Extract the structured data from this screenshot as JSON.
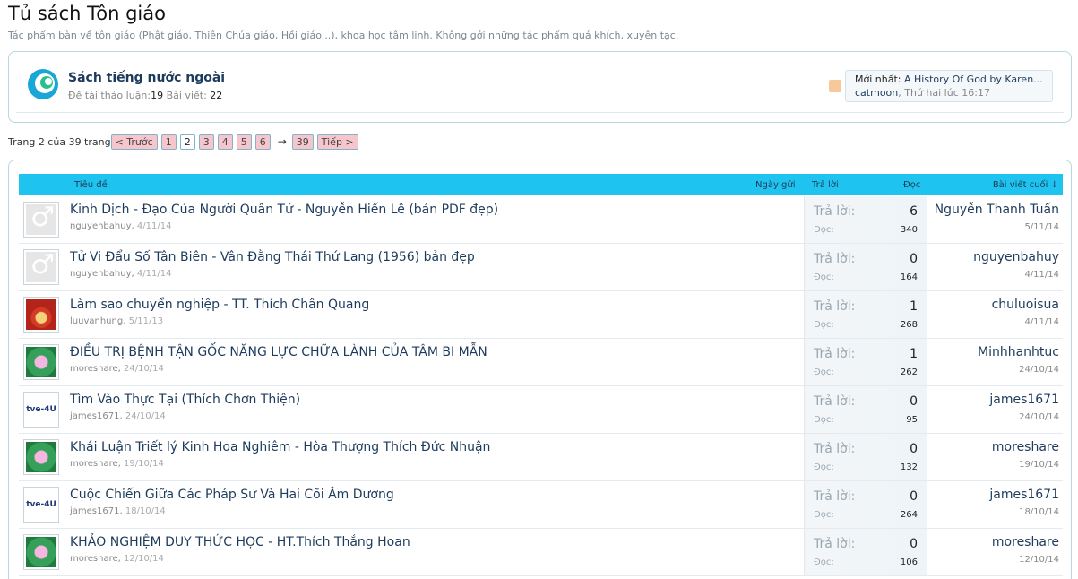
{
  "page": {
    "title": "Tủ sách Tôn giáo",
    "description": "Tác phẩm bàn về tôn giáo (Phật giáo, Thiên Chúa giáo, Hồi giáo...), khoa học tâm linh. Không gởi những tác phẩm quá khích, xuyên tạc."
  },
  "subforum": {
    "name": "Sách tiếng nước ngoài",
    "threads_label": "Đề tài thảo luận:",
    "threads": "19",
    "posts_label": "Bài viết:",
    "posts": "22",
    "latest_label": "Mới nhất:",
    "latest_title": "A History Of God by Karen...",
    "latest_user": "catmoon",
    "latest_time": "Thứ hai lúc 16:17"
  },
  "pagination": {
    "label": "Trang 2 của 39 trang",
    "prev": "< Trước",
    "pages": [
      "1",
      "2",
      "3",
      "4",
      "5",
      "6"
    ],
    "current": "2",
    "arrow": "→",
    "last": "39",
    "next": "Tiếp >"
  },
  "table_header": {
    "title": "Tiêu đề",
    "date": "Ngày gửi",
    "replies": "Trả lời",
    "views": "Đọc",
    "last_post": "Bài viết cuối ↓"
  },
  "labels": {
    "replies": "Trả lời:",
    "views": "Đọc:"
  },
  "threads": [
    {
      "title": "Kinh Dịch - Đạo Của Người Quân Tử - Nguyễn Hiến Lê (bản PDF đẹp)",
      "author": "nguyenbahuy",
      "date": "4/11/14",
      "replies": "6",
      "views": "340",
      "last_user": "Nguyễn Thanh Tuấn",
      "last_date": "5/11/14",
      "avatar": "default"
    },
    {
      "title": "Tử Vi Đẩu Số Tân Biên - Vân Đằng Thái Thứ Lang (1956) bản đẹp",
      "author": "nguyenbahuy",
      "date": "4/11/14",
      "replies": "0",
      "views": "164",
      "last_user": "nguyenbahuy",
      "last_date": "4/11/14",
      "avatar": "default"
    },
    {
      "title": "Làm sao chuyển nghiệp - TT. Thích Chân Quang",
      "author": "luuvanhung",
      "date": "5/11/13",
      "replies": "1",
      "views": "268",
      "last_user": "chuluoisua",
      "last_date": "4/11/14",
      "avatar": "temple"
    },
    {
      "title": "ĐIỀU TRỊ BỆNH TẬN GỐC NĂNG LỰC CHỮA LÀNH CỦA TÂM BI MẪN",
      "author": "moreshare",
      "date": "24/10/14",
      "replies": "1",
      "views": "262",
      "last_user": "Minhhanhtuc",
      "last_date": "24/10/14",
      "avatar": "lotus"
    },
    {
      "title": "Tìm Vào Thực Tại (Thích Chơn Thiện)",
      "author": "james1671",
      "date": "24/10/14",
      "replies": "0",
      "views": "95",
      "last_user": "james1671",
      "last_date": "24/10/14",
      "avatar": "tve"
    },
    {
      "title": "Khái Luận Triết lý Kinh Hoa Nghiêm - Hòa Thượng Thích Đức Nhuận",
      "author": "moreshare",
      "date": "19/10/14",
      "replies": "0",
      "views": "132",
      "last_user": "moreshare",
      "last_date": "19/10/14",
      "avatar": "lotus"
    },
    {
      "title": "Cuộc Chiến Giữa Các Pháp Sư Và Hai Cõi Âm Dương",
      "author": "james1671",
      "date": "18/10/14",
      "replies": "0",
      "views": "264",
      "last_user": "james1671",
      "last_date": "18/10/14",
      "avatar": "tve"
    },
    {
      "title": "KHẢO NGHIỆM DUY THỨC HỌC - HT.Thích Thắng Hoan",
      "author": "moreshare",
      "date": "12/10/14",
      "replies": "0",
      "views": "106",
      "last_user": "moreshare",
      "last_date": "12/10/14",
      "avatar": "lotus"
    }
  ],
  "avatar_text": {
    "tve": "tve-4U"
  }
}
